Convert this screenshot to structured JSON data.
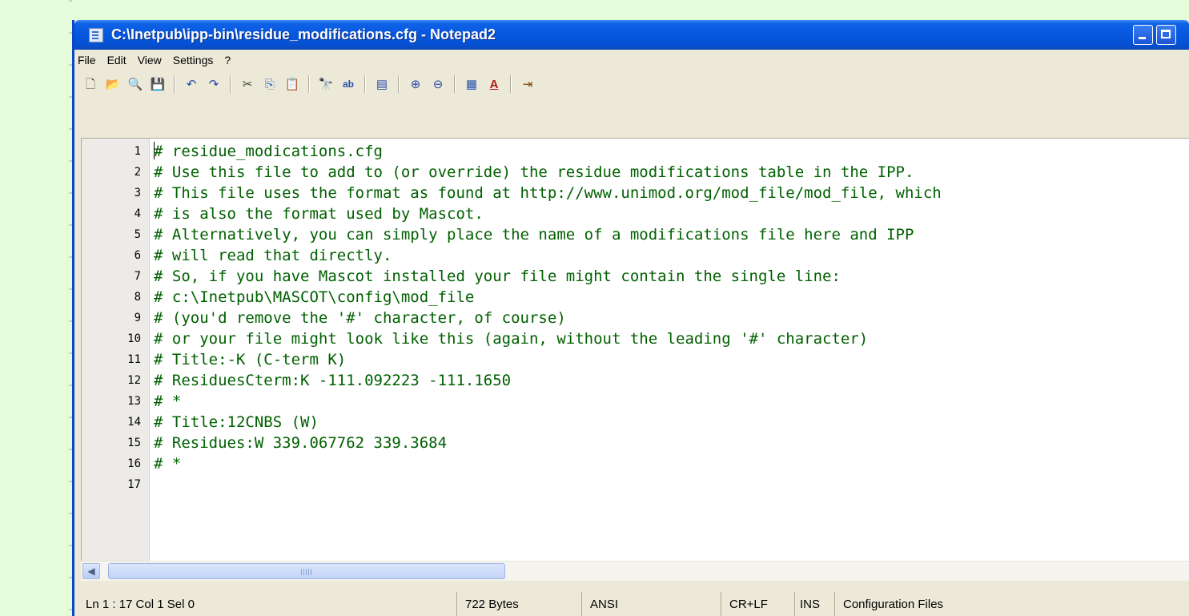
{
  "window": {
    "title": "C:\\Inetpub\\ipp-bin\\residue_modifications.cfg - Notepad2"
  },
  "menu": [
    "File",
    "Edit",
    "View",
    "Settings",
    "?"
  ],
  "toolbar": [
    {
      "name": "new-file-icon",
      "glyph": "🗋"
    },
    {
      "name": "open-folder-icon",
      "glyph": "📂"
    },
    {
      "name": "browse-icon",
      "glyph": "🔍"
    },
    {
      "name": "save-icon",
      "glyph": "💾"
    },
    {
      "sep": true
    },
    {
      "name": "undo-icon",
      "glyph": "↶"
    },
    {
      "name": "redo-icon",
      "glyph": "↷"
    },
    {
      "sep": true
    },
    {
      "name": "cut-icon",
      "glyph": "✂"
    },
    {
      "name": "copy-icon",
      "glyph": "⎘"
    },
    {
      "name": "paste-icon",
      "glyph": "📋"
    },
    {
      "sep": true
    },
    {
      "name": "find-icon",
      "glyph": "🔭"
    },
    {
      "name": "replace-icon",
      "glyph": "ab"
    },
    {
      "sep": true
    },
    {
      "name": "word-wrap-icon",
      "glyph": "▤"
    },
    {
      "sep": true
    },
    {
      "name": "zoom-in-icon",
      "glyph": "⊕"
    },
    {
      "name": "zoom-out-icon",
      "glyph": "⊖"
    },
    {
      "sep": true
    },
    {
      "name": "scheme-icon",
      "glyph": "▦"
    },
    {
      "name": "font-icon",
      "glyph": "A"
    },
    {
      "sep": true
    },
    {
      "name": "exit-icon",
      "glyph": "⇥"
    }
  ],
  "editor": {
    "lines": [
      "# residue_modications.cfg",
      "# Use this file to add to (or override) the residue modifications table in the IPP.",
      "# This file uses the format as found at http://www.unimod.org/mod_file/mod_file, which",
      "# is also the format used by Mascot.",
      "# Alternatively, you can simply place the name of a modifications file here and IPP",
      "# will read that directly.",
      "# So, if you have Mascot installed your file might contain the single line:",
      "# c:\\Inetpub\\MASCOT\\config\\mod_file",
      "# (you'd remove the '#' character, of course)",
      "# or your file might look like this (again, without the leading '#' character)",
      "# Title:-K (C-term K)",
      "# ResiduesCterm:K -111.092223 -111.1650",
      "# *",
      "# Title:12CNBS (W)",
      "# Residues:W 339.067762 339.3684",
      "# *",
      ""
    ],
    "line_numbers": [
      "1",
      "2",
      "3",
      "4",
      "5",
      "6",
      "7",
      "8",
      "9",
      "10",
      "11",
      "12",
      "13",
      "14",
      "15",
      "16",
      "17"
    ],
    "text_color": "#006000"
  },
  "status": {
    "position": "Ln 1 : 17   Col 1   Sel 0",
    "size": "722 Bytes",
    "encoding": "ANSI",
    "eol": "CR+LF",
    "mode": "INS",
    "scheme": "Configuration Files"
  }
}
